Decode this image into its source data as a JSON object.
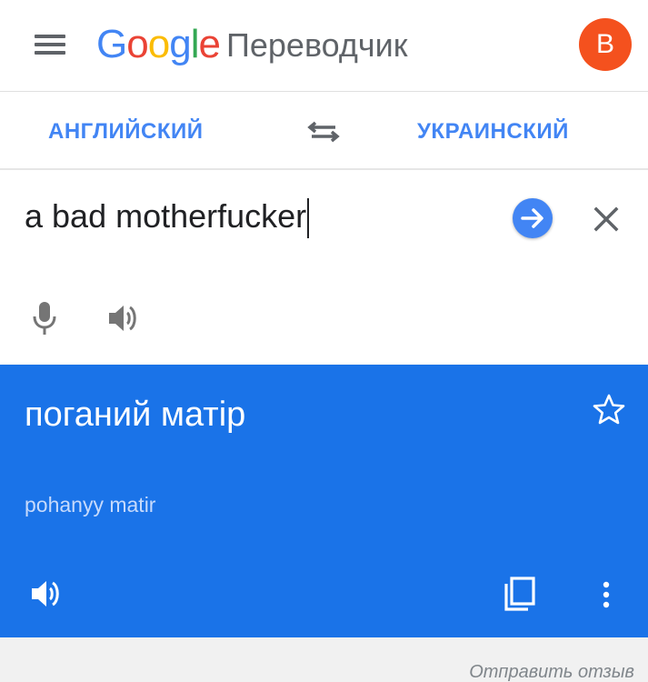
{
  "header": {
    "logo": {
      "G": "G",
      "o1": "o",
      "o2": "o",
      "g": "g",
      "l": "l",
      "e": "e"
    },
    "product": "Переводчик",
    "avatar_letter": "В"
  },
  "languages": {
    "source": "АНГЛИЙСКИЙ",
    "target": "УКРАИНСКИЙ"
  },
  "input": {
    "text": "a bad motherfucker"
  },
  "result": {
    "translation": "поганий матір",
    "transliteration": "pohanyy matir"
  },
  "footer": {
    "feedback": "Отправить отзыв"
  },
  "colors": {
    "accent": "#4285f4",
    "result_bg": "#1a73e8",
    "avatar_bg": "#f4511e"
  },
  "icons": [
    "menu-icon",
    "swap-icon",
    "arrow-right-icon",
    "close-icon",
    "mic-icon",
    "speaker-icon",
    "star-icon",
    "copy-icon",
    "more-vert-icon"
  ]
}
